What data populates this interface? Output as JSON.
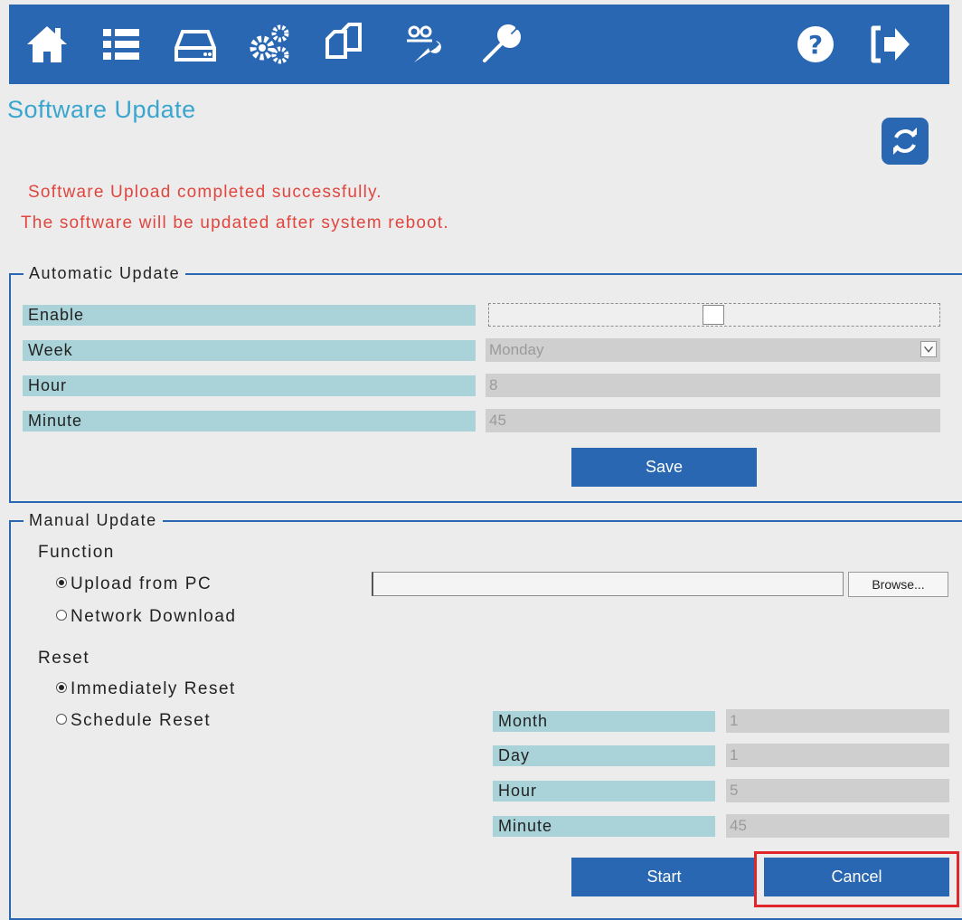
{
  "header": {
    "icons": [
      "home-icon",
      "list-icon",
      "drive-icon",
      "gears-icon",
      "copy-icon",
      "service-icon",
      "wrench-icon",
      "help-icon",
      "logout-icon"
    ]
  },
  "page": {
    "title": "Software Update",
    "message_line1": "Software Upload completed successfully.",
    "message_line2": "The software will be updated after system reboot."
  },
  "automatic": {
    "legend": "Automatic Update",
    "enable_label": "Enable",
    "week_label": "Week",
    "week_value": "Monday",
    "hour_label": "Hour",
    "hour_value": "8",
    "minute_label": "Minute",
    "minute_value": "45",
    "save_label": "Save"
  },
  "manual": {
    "legend": "Manual Update",
    "function_label": "Function",
    "upload_label": "Upload from PC",
    "network_label": "Network Download",
    "browse_label": "Browse...",
    "reset_label": "Reset",
    "immediate_label": "Immediately Reset",
    "schedule_label": "Schedule Reset",
    "month_label": "Month",
    "month_value": "1",
    "day_label": "Day",
    "day_value": "1",
    "hour_label": "Hour",
    "hour_value": "5",
    "minute_label": "Minute",
    "minute_value": "45",
    "start_label": "Start",
    "cancel_label": "Cancel"
  },
  "colors": {
    "header_bg": "#2a67b2",
    "title": "#3aa6cf",
    "message": "#e0463f",
    "label_bg": "#a9d3d8",
    "value_bg": "#cfcfcf",
    "highlight": "#e0262b"
  }
}
